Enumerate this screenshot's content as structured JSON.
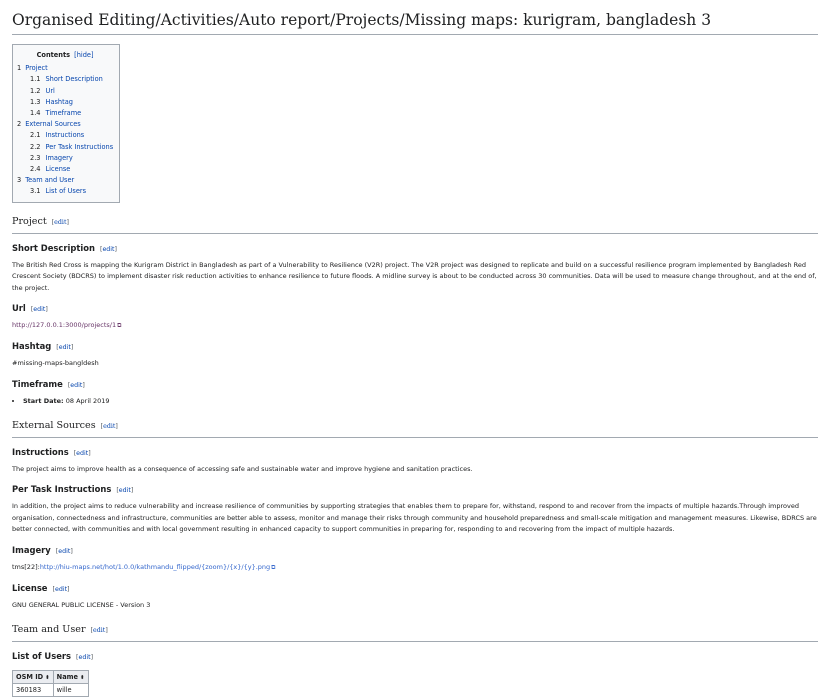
{
  "page": {
    "title": "Organised Editing/Activities/Auto report/Projects/Missing maps: kurigram, bangladesh 3"
  },
  "toc": {
    "title": "Contents",
    "hide_label": "[hide]",
    "items": [
      {
        "num": "1",
        "label": "Project",
        "level": 1
      },
      {
        "num": "1.1",
        "label": "Short Description",
        "level": 2
      },
      {
        "num": "1.2",
        "label": "Url",
        "level": 2
      },
      {
        "num": "1.3",
        "label": "Hashtag",
        "level": 2
      },
      {
        "num": "1.4",
        "label": "Timeframe",
        "level": 2
      },
      {
        "num": "2",
        "label": "External Sources",
        "level": 1
      },
      {
        "num": "2.1",
        "label": "Instructions",
        "level": 2
      },
      {
        "num": "2.2",
        "label": "Per Task Instructions",
        "level": 2
      },
      {
        "num": "2.3",
        "label": "Imagery",
        "level": 2
      },
      {
        "num": "2.4",
        "label": "License",
        "level": 2
      },
      {
        "num": "3",
        "label": "Team and User",
        "level": 1
      },
      {
        "num": "3.1",
        "label": "List of Users",
        "level": 2
      }
    ]
  },
  "edit_label": "edit",
  "project": {
    "heading": "Project",
    "short_description": {
      "heading": "Short Description",
      "text": "The British Red Cross is mapping the Kurigram District in Bangladesh as part of a Vulnerability to Resilience (V2R) project. The V2R project was designed to replicate and build on a successful resilience program implemented by Bangladesh Red Crescent Society (BDCRS) to implement disaster risk reduction activities to enhance resilience to future floods. A midline survey is about to be conducted across 30 communities. Data will be used to measure change throughout, and at the end of, the project."
    },
    "url": {
      "heading": "Url",
      "link": "http://127.0.0.1:3000/projects/1"
    },
    "hashtag": {
      "heading": "Hashtag",
      "value": "#missing-maps-bangldesh"
    },
    "timeframe": {
      "heading": "Timeframe",
      "start_label": "Start Date:",
      "start_value": "08 April 2019"
    }
  },
  "external": {
    "heading": "External Sources",
    "instructions": {
      "heading": "Instructions",
      "text": "The project aims to improve health as a consequence of accessing safe and sustainable water and improve hygiene and sanitation practices."
    },
    "per_task": {
      "heading": "Per Task Instructions",
      "text": "In addition, the project aims to reduce vulnerability and increase resilience of communities by supporting strategies that enables them to prepare for, withstand, respond to and recover from the impacts of multiple hazards.Through improved organisation, connectedness and infrastructure, communities are better able to assess, monitor and manage their risks through community and household preparedness and small-scale mitigation and management measures. Likewise, BDRCS are better connected, with communities and with local government resulting in enhanced capacity to support communities in preparing for, responding to and recovering from the impact of multiple hazards."
    },
    "imagery": {
      "heading": "Imagery",
      "prefix": "tms[22]:",
      "link": "http://hiu-maps.net/hot/1.0.0/kathmandu_flipped/{zoom}/{x}/{y}.png"
    },
    "license": {
      "heading": "License",
      "text": "GNU GENERAL PUBLIC LICENSE - Version 3"
    }
  },
  "team": {
    "heading": "Team and User",
    "users": {
      "heading": "List of Users",
      "columns": [
        "OSM ID",
        "Name"
      ],
      "rows": [
        [
          "360183",
          "wille"
        ]
      ]
    }
  },
  "icons": {
    "external_link": "external-link-icon",
    "sort": "sort-icon"
  }
}
